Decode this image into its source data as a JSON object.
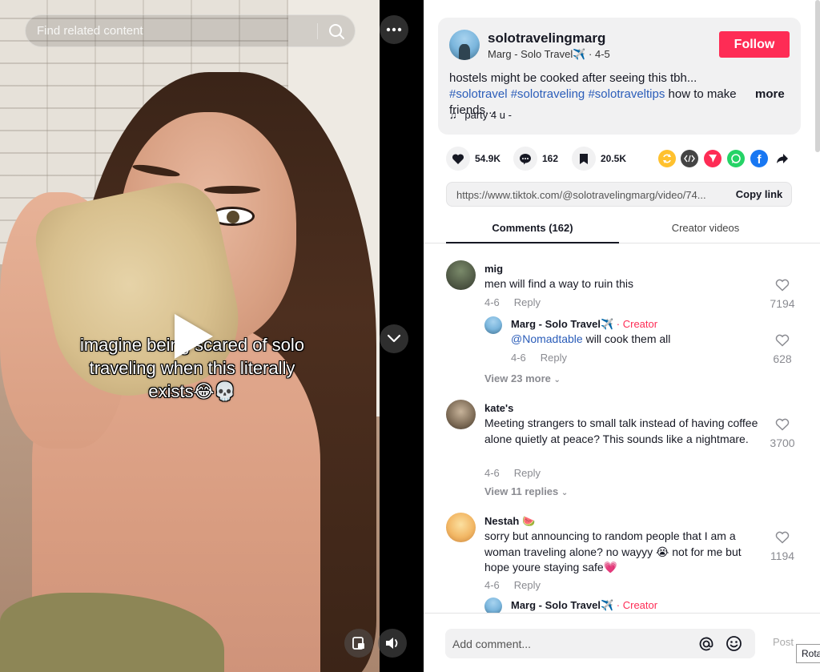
{
  "video": {
    "search_placeholder": "Find related content",
    "caption_line1": "imagine being scared of solo",
    "caption_line2": "traveling when this literally",
    "caption_line3": "exists😂💀"
  },
  "author": {
    "username": "solotravelingmarg",
    "display_name": "Marg - Solo Travel✈️",
    "date": "4-5",
    "follow_label": "Follow",
    "desc_text": "hostels might be cooked after seeing this tbh... ",
    "hashtags": [
      "#solotravel",
      "#solotraveling",
      "#solotraveltips"
    ],
    "desc_tail": " how to make friends...",
    "more_label": "more",
    "music": "party 4 u -"
  },
  "actions": {
    "likes": "54.9K",
    "comments": "162",
    "saves": "20.5K"
  },
  "share": {
    "link": "https://www.tiktok.com/@solotravelingmarg/video/74...",
    "copy_label": "Copy link"
  },
  "tabs": {
    "comments": "Comments (162)",
    "creator_videos": "Creator videos"
  },
  "comments": [
    {
      "name": "mig",
      "text": "men will find a way to ruin this",
      "date": "4-6",
      "reply_label": "Reply",
      "likes": "7194",
      "reply": {
        "name": "Marg - Solo Travel✈️",
        "creator_tag": "· Creator",
        "mention": "@Nomadtable",
        "text": " will cook them all",
        "date": "4-6",
        "reply_label": "Reply",
        "likes": "628"
      },
      "view_more": "View 23 more"
    },
    {
      "name": "kate's",
      "text": "Meeting strangers to small talk instead of having coffee alone quietly at peace? This sounds like a nightmare.",
      "date": "4-6",
      "reply_label": "Reply",
      "likes": "3700",
      "view_more": "View 11 replies"
    },
    {
      "name": "Nestah 🍉",
      "text": "sorry but announcing to random people that I am a woman traveling alone? no wayyy 😭 not for me but hope youre staying safe💗",
      "date": "4-6",
      "reply_label": "Reply",
      "likes": "1194",
      "reply": {
        "name": "Marg - Solo Travel✈️",
        "creator_tag": "· Creator"
      }
    }
  ],
  "footer": {
    "comment_placeholder": "Add comment...",
    "post_label": "Post",
    "tooltip": "Rota"
  },
  "colors": {
    "accent": "#fe2c55",
    "link": "#2b5db9"
  }
}
